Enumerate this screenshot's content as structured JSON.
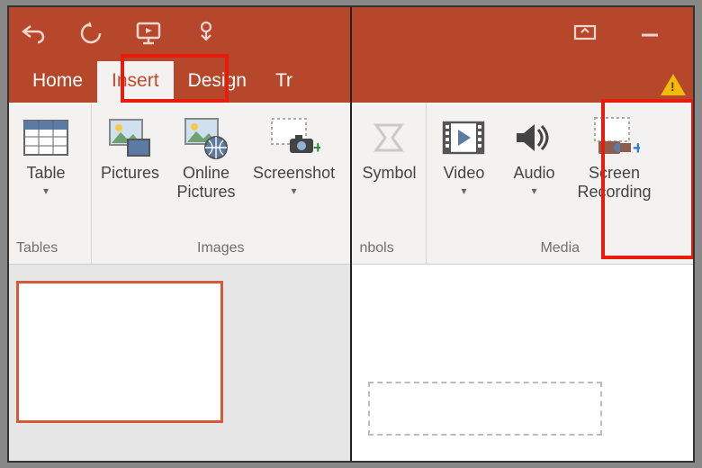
{
  "left": {
    "tabs": {
      "home": "Home",
      "insert": "Insert",
      "design": "Design",
      "transitions": "Tr"
    },
    "ribbon": {
      "tables": {
        "table": "Table",
        "group": "Tables"
      },
      "images": {
        "pictures": "Pictures",
        "online": "Online\nPictures",
        "screenshot": "Screenshot",
        "group": "Images"
      }
    }
  },
  "right": {
    "ribbon": {
      "symbols": {
        "symbol": "Symbol",
        "group": "nbols"
      },
      "media": {
        "video": "Video",
        "audio": "Audio",
        "screenrec": "Screen\nRecording",
        "group": "Media"
      }
    }
  }
}
